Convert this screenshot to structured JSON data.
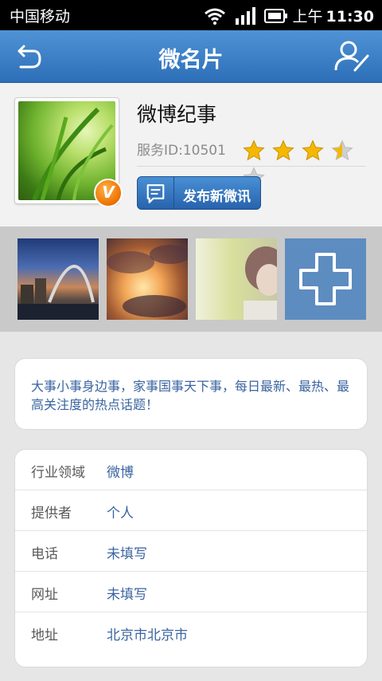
{
  "status_bar": {
    "carrier": "中国移动",
    "ampm": "上午",
    "time": "11:30",
    "icons": [
      "wifi-icon",
      "signal-icon",
      "battery-icon"
    ]
  },
  "header": {
    "title": "微名片",
    "back_icon": "back-arrow-icon",
    "edit_icon": "edit-profile-icon",
    "color": "#3b7fc8"
  },
  "profile": {
    "name": "微博纪事",
    "service_id": "服务ID:10501",
    "verified_badge": "V",
    "rating": 3.5,
    "rating_max": 5,
    "post_button_label": "发布新微讯",
    "post_button_icon": "compose-icon"
  },
  "gallery": {
    "thumbnails": [
      "bridge-city-photo",
      "sunset-clouds-photo",
      "girl-meadow-photo"
    ],
    "add_icon": "plus-icon"
  },
  "description": "大事小事身边事，家事国事天下事，每日最新、最热、最高关注度的热点话题！",
  "info": [
    {
      "label": "行业领域",
      "value": "微博"
    },
    {
      "label": "提供者",
      "value": "个人"
    },
    {
      "label": "电话",
      "value": "未填写"
    },
    {
      "label": "网址",
      "value": "未填写"
    },
    {
      "label": "地址",
      "value": "北京市北京市"
    }
  ],
  "colors": {
    "accent": "#3b7fc8",
    "value_text": "#3a64a0",
    "star": "#f5b800"
  }
}
